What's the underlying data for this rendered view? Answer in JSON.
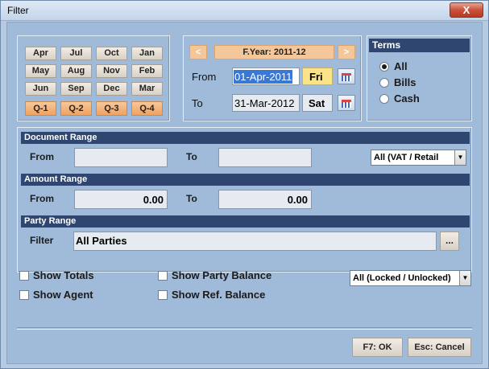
{
  "window": {
    "title": "Filter",
    "close_label": "X"
  },
  "months": {
    "row1": [
      "Apr",
      "Jul",
      "Oct",
      "Jan"
    ],
    "row2": [
      "May",
      "Aug",
      "Nov",
      "Feb"
    ],
    "row3": [
      "Jun",
      "Sep",
      "Dec",
      "Mar"
    ],
    "quarters": [
      "Q-1",
      "Q-2",
      "Q-3",
      "Q-4"
    ]
  },
  "fyear": {
    "prev": "<",
    "label": "F.Year: 2011-12",
    "next": ">"
  },
  "dates": {
    "from_label": "From",
    "from_value": "01-Apr-2011",
    "from_day": "Fri",
    "to_label": "To",
    "to_value": "31-Mar-2012",
    "to_day": "Sat"
  },
  "terms": {
    "header": "Terms",
    "options": [
      "All",
      "Bills",
      "Cash"
    ],
    "selected": "All"
  },
  "document_range": {
    "header": "Document Range",
    "from_label": "From",
    "to_label": "To",
    "type_select": "All (VAT / Retail"
  },
  "amount_range": {
    "header": "Amount Range",
    "from_label": "From",
    "from_value": "0.00",
    "to_label": "To",
    "to_value": "0.00"
  },
  "party_range": {
    "header": "Party Range",
    "filter_label": "Filter",
    "filter_value": "All Parties",
    "browse_label": "..."
  },
  "options": {
    "show_totals": "Show Totals",
    "show_agent": "Show Agent",
    "show_party_balance": "Show Party Balance",
    "show_ref_balance": "Show Ref. Balance",
    "lock_select": "All (Locked / Unlocked)"
  },
  "actions": {
    "ok": "F7: OK",
    "cancel": "Esc: Cancel"
  }
}
